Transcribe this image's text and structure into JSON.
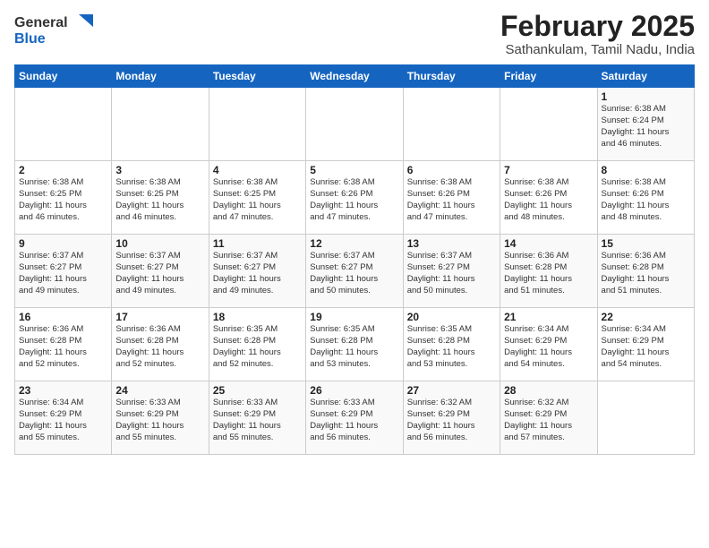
{
  "header": {
    "logo_general": "General",
    "logo_blue": "Blue",
    "month_title": "February 2025",
    "location": "Sathankulam, Tamil Nadu, India"
  },
  "weekdays": [
    "Sunday",
    "Monday",
    "Tuesday",
    "Wednesday",
    "Thursday",
    "Friday",
    "Saturday"
  ],
  "weeks": [
    [
      {
        "day": "",
        "info": ""
      },
      {
        "day": "",
        "info": ""
      },
      {
        "day": "",
        "info": ""
      },
      {
        "day": "",
        "info": ""
      },
      {
        "day": "",
        "info": ""
      },
      {
        "day": "",
        "info": ""
      },
      {
        "day": "1",
        "info": "Sunrise: 6:38 AM\nSunset: 6:24 PM\nDaylight: 11 hours\nand 46 minutes."
      }
    ],
    [
      {
        "day": "2",
        "info": "Sunrise: 6:38 AM\nSunset: 6:25 PM\nDaylight: 11 hours\nand 46 minutes."
      },
      {
        "day": "3",
        "info": "Sunrise: 6:38 AM\nSunset: 6:25 PM\nDaylight: 11 hours\nand 46 minutes."
      },
      {
        "day": "4",
        "info": "Sunrise: 6:38 AM\nSunset: 6:25 PM\nDaylight: 11 hours\nand 47 minutes."
      },
      {
        "day": "5",
        "info": "Sunrise: 6:38 AM\nSunset: 6:26 PM\nDaylight: 11 hours\nand 47 minutes."
      },
      {
        "day": "6",
        "info": "Sunrise: 6:38 AM\nSunset: 6:26 PM\nDaylight: 11 hours\nand 47 minutes."
      },
      {
        "day": "7",
        "info": "Sunrise: 6:38 AM\nSunset: 6:26 PM\nDaylight: 11 hours\nand 48 minutes."
      },
      {
        "day": "8",
        "info": "Sunrise: 6:38 AM\nSunset: 6:26 PM\nDaylight: 11 hours\nand 48 minutes."
      }
    ],
    [
      {
        "day": "9",
        "info": "Sunrise: 6:37 AM\nSunset: 6:27 PM\nDaylight: 11 hours\nand 49 minutes."
      },
      {
        "day": "10",
        "info": "Sunrise: 6:37 AM\nSunset: 6:27 PM\nDaylight: 11 hours\nand 49 minutes."
      },
      {
        "day": "11",
        "info": "Sunrise: 6:37 AM\nSunset: 6:27 PM\nDaylight: 11 hours\nand 49 minutes."
      },
      {
        "day": "12",
        "info": "Sunrise: 6:37 AM\nSunset: 6:27 PM\nDaylight: 11 hours\nand 50 minutes."
      },
      {
        "day": "13",
        "info": "Sunrise: 6:37 AM\nSunset: 6:27 PM\nDaylight: 11 hours\nand 50 minutes."
      },
      {
        "day": "14",
        "info": "Sunrise: 6:36 AM\nSunset: 6:28 PM\nDaylight: 11 hours\nand 51 minutes."
      },
      {
        "day": "15",
        "info": "Sunrise: 6:36 AM\nSunset: 6:28 PM\nDaylight: 11 hours\nand 51 minutes."
      }
    ],
    [
      {
        "day": "16",
        "info": "Sunrise: 6:36 AM\nSunset: 6:28 PM\nDaylight: 11 hours\nand 52 minutes."
      },
      {
        "day": "17",
        "info": "Sunrise: 6:36 AM\nSunset: 6:28 PM\nDaylight: 11 hours\nand 52 minutes."
      },
      {
        "day": "18",
        "info": "Sunrise: 6:35 AM\nSunset: 6:28 PM\nDaylight: 11 hours\nand 52 minutes."
      },
      {
        "day": "19",
        "info": "Sunrise: 6:35 AM\nSunset: 6:28 PM\nDaylight: 11 hours\nand 53 minutes."
      },
      {
        "day": "20",
        "info": "Sunrise: 6:35 AM\nSunset: 6:28 PM\nDaylight: 11 hours\nand 53 minutes."
      },
      {
        "day": "21",
        "info": "Sunrise: 6:34 AM\nSunset: 6:29 PM\nDaylight: 11 hours\nand 54 minutes."
      },
      {
        "day": "22",
        "info": "Sunrise: 6:34 AM\nSunset: 6:29 PM\nDaylight: 11 hours\nand 54 minutes."
      }
    ],
    [
      {
        "day": "23",
        "info": "Sunrise: 6:34 AM\nSunset: 6:29 PM\nDaylight: 11 hours\nand 55 minutes."
      },
      {
        "day": "24",
        "info": "Sunrise: 6:33 AM\nSunset: 6:29 PM\nDaylight: 11 hours\nand 55 minutes."
      },
      {
        "day": "25",
        "info": "Sunrise: 6:33 AM\nSunset: 6:29 PM\nDaylight: 11 hours\nand 55 minutes."
      },
      {
        "day": "26",
        "info": "Sunrise: 6:33 AM\nSunset: 6:29 PM\nDaylight: 11 hours\nand 56 minutes."
      },
      {
        "day": "27",
        "info": "Sunrise: 6:32 AM\nSunset: 6:29 PM\nDaylight: 11 hours\nand 56 minutes."
      },
      {
        "day": "28",
        "info": "Sunrise: 6:32 AM\nSunset: 6:29 PM\nDaylight: 11 hours\nand 57 minutes."
      },
      {
        "day": "",
        "info": ""
      }
    ]
  ]
}
